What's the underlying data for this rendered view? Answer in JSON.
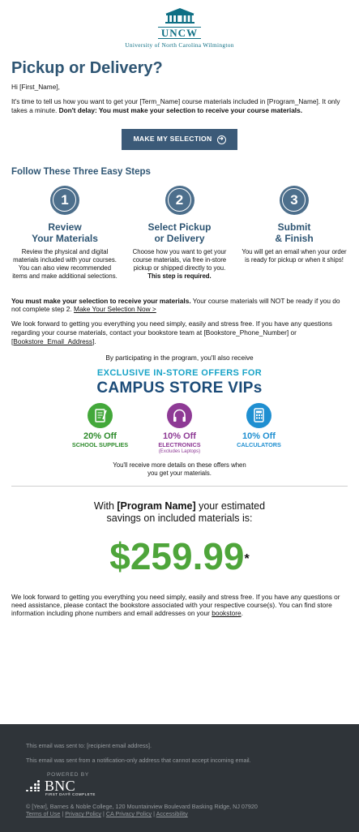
{
  "header": {
    "logo_text": "UNCW",
    "university": "University of North Carolina Wilmington"
  },
  "title": "Pickup or Delivery?",
  "greeting": "Hi [First_Name],",
  "intro": {
    "text": "It's time to tell us how you want to get your [Term_Name] course materials included in [Program_Name]. It only takes a minute. ",
    "bold": "Don't delay: You must make your selection to receive your course materials."
  },
  "cta": {
    "label": "MAKE MY SELECTION"
  },
  "steps_heading": "Follow These Three Easy Steps",
  "steps": [
    {
      "num": "1",
      "title_1": "Review",
      "title_2": "Your Materials",
      "desc": "Review the physical and digital materials included with your courses. You can also view recommended items and make additional selections.",
      "desc_bold": ""
    },
    {
      "num": "2",
      "title_1": "Select Pickup",
      "title_2": "or Delivery",
      "desc": "Choose how you want to get your course materials, via free in-store pickup or shipped directly to you.",
      "desc_bold": "This step is required."
    },
    {
      "num": "3",
      "title_1": "Submit",
      "title_2": "& Finish",
      "desc": "You will get an email when your order is ready for pickup or when it ships!",
      "desc_bold": ""
    }
  ],
  "must": {
    "bold": "You must make your selection to receive your materials.",
    "text": " Your course materials will NOT be ready if you do not complete step 2.  ",
    "link": "Make Your Selection Now >"
  },
  "contact": {
    "text": "We look forward to getting you everything you need simply, easily and stress free. If you have any questions regarding your course materials, contact your bookstore team at [Bookstore_Phone_Number] or ",
    "link": "[Bookstore_Email_Address]",
    "end": "."
  },
  "vip": {
    "intro": "By participating in the program, you'll also receive",
    "line1": "EXCLUSIVE IN-STORE OFFERS FOR",
    "line2": "CAMPUS STORE VIPs",
    "offers": [
      {
        "title": "20% Off",
        "sub": "SCHOOL SUPPLIES",
        "note": "",
        "color": "#43a83a",
        "icon": "notebook-icon"
      },
      {
        "title": "10% Off",
        "sub": "ELECTRONICS",
        "note": "(Excludes Laptops)",
        "color": "#8e3a95",
        "icon": "headphones-icon"
      },
      {
        "title": "10% Off",
        "sub": "CALCULATORS",
        "note": "",
        "color": "#1f8fd1",
        "icon": "calculator-icon"
      }
    ],
    "details": "You'll receive more details on these offers when you get your materials."
  },
  "savings": {
    "pre": "With ",
    "program": "[Program Name]",
    "post": " your estimated savings on included materials is:",
    "amount": "$259.99",
    "asterisk": "*"
  },
  "closing": {
    "text": "We look forward to getting you everything you need simply, easily and stress free. If you have any questions or need assistance, please contact the bookstore associated with your respective course(s). You can find store information including phone numbers and email addresses on your ",
    "link": "bookstore",
    "end": "."
  },
  "footer": {
    "sent_to": "This email was sent to: [recipient email address].",
    "notice": "This email was sent from a notification-only address that cannot accept incoming email.",
    "powered": "POWERED BY",
    "brand": "BNC",
    "brand_sub": "FIRST DAY® COMPLETE",
    "copyright": "© [Year], Barnes & Noble College, 120 Mountainview Boulevard Basking Ridge, NJ 07920",
    "links": [
      "Terms of Use",
      "Privacy Policy",
      "CA Privacy Policy",
      "Accessibility"
    ],
    "sep": " | "
  }
}
